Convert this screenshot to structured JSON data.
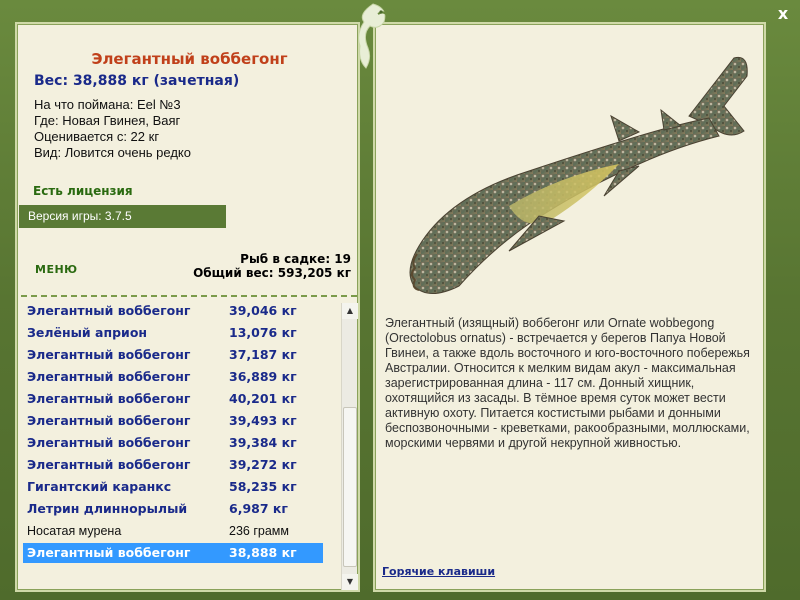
{
  "window": {
    "close_label": "x"
  },
  "fish": {
    "title": "Элегантный воббегонг",
    "weight_line": "Вес: 38,888 кг (зачетная)",
    "caught_on": "На что поймана: Eel №3",
    "location": "Где: Новая Гвинея, Ваяг",
    "valued_from": "Оценивается с: 22 кг",
    "type": "Вид: Ловится очень редко"
  },
  "license": "Есть лицензия",
  "version": "Версия игры: 3.7.5",
  "menu_label": "МЕНЮ",
  "cage": {
    "count_line": "Рыб в садке: 19",
    "total_line": "Общий вес: 593,205 кг"
  },
  "catches": [
    {
      "name": "Элегантный воббегонг",
      "weight": "39,046 кг",
      "style": "bold"
    },
    {
      "name": "Зелёный априон",
      "weight": "13,076 кг",
      "style": "bold"
    },
    {
      "name": "Элегантный воббегонг",
      "weight": "37,187 кг",
      "style": "bold"
    },
    {
      "name": "Элегантный воббегонг",
      "weight": "36,889 кг",
      "style": "bold"
    },
    {
      "name": "Элегантный воббегонг",
      "weight": "40,201 кг",
      "style": "bold"
    },
    {
      "name": "Элегантный воббегонг",
      "weight": "39,493 кг",
      "style": "bold"
    },
    {
      "name": "Элегантный воббегонг",
      "weight": "39,384 кг",
      "style": "bold"
    },
    {
      "name": "Элегантный воббегонг",
      "weight": "39,272 кг",
      "style": "bold"
    },
    {
      "name": "Гигантский каранкс",
      "weight": "58,235 кг",
      "style": "bold"
    },
    {
      "name": "Летрин длиннорылый",
      "weight": "6,987 кг",
      "style": "bold"
    },
    {
      "name": "Носатая мурена",
      "weight": "236 грамм",
      "style": "plain"
    },
    {
      "name": "Элегантный воббегонг",
      "weight": "38,888 кг",
      "style": "selected"
    }
  ],
  "description": "Элегантный (изящный) воббегонг или Ornate wobbegong (Orectolobus ornatus) - встречается у берегов Папуа Новой Гвинеи, а также вдоль восточного и юго-восточного побережья Австралии. Относится к мелким видам акул - максимальная зарегистрированная длина - 117 см. Донный хищник, охотящийся из засады. В тёмное время суток может вести активную охоту. Питается костистыми рыбами и донными беспозвоночными - креветками, ракообразными, моллюсками, морскими червями и другой некрупной живностью.",
  "hotkeys_label": "Горячие клавиши",
  "icons": {
    "logo": "fish-logo-icon",
    "scroll_up": "scroll-up-icon",
    "scroll_down": "scroll-down-icon"
  },
  "colors": {
    "frame": "#5c7a35",
    "panel": "#f3f0de",
    "title": "#c0401a",
    "link": "#1a2a8a",
    "selection": "#3399ff"
  }
}
